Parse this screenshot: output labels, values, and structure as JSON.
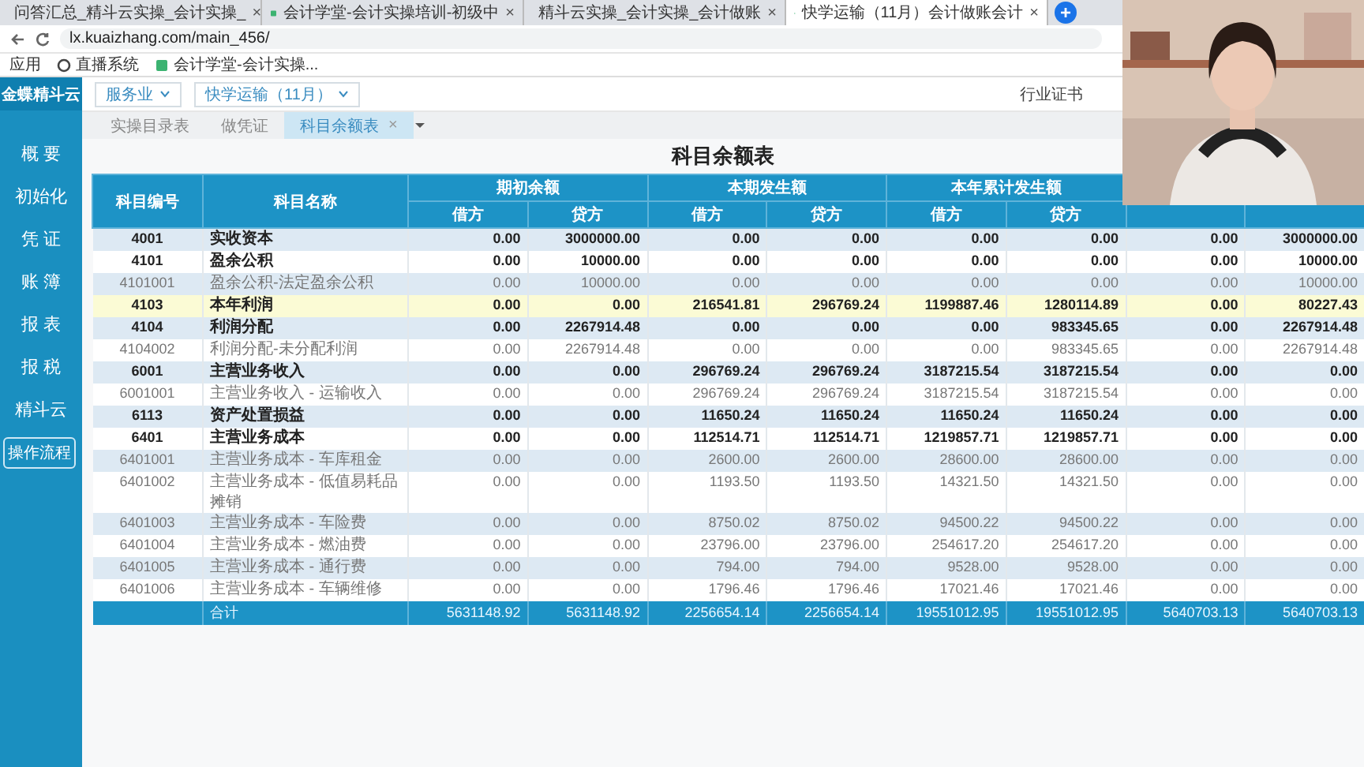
{
  "browser": {
    "tabs": [
      {
        "title": "问答汇总_精斗云实操_会计实操_",
        "selected": false,
        "close": "×"
      },
      {
        "title": "会计学堂-会计实操培训-初级中",
        "selected": false,
        "close": "×"
      },
      {
        "title": "精斗云实操_会计实操_会计做账",
        "selected": false,
        "close": "×"
      },
      {
        "title": "快学运输（11月）会计做账会计",
        "selected": true,
        "close": "×"
      }
    ],
    "new_tab": "+",
    "address": "lx.kuaizhang.com/main_456/",
    "bookmarks": [
      "应用",
      "直播系统",
      "会计学堂-会计实操..."
    ]
  },
  "app": {
    "logo": "金蝶精斗云",
    "sidebar": {
      "items": [
        "概 要",
        "初始化",
        "凭 证",
        "账 簿",
        "报 表",
        "报 税",
        "精斗云"
      ],
      "button": "操作流程"
    },
    "topbar": {
      "industry": "服务业",
      "company": "快学运输（11月）",
      "right_link": "行业证书"
    },
    "tabs": [
      {
        "label": "实操目录表",
        "selected": false
      },
      {
        "label": "做凭证",
        "selected": false
      },
      {
        "label": "科目余额表",
        "selected": true,
        "close": "×"
      }
    ],
    "title": "科目余额表",
    "table": {
      "columns": [
        "科目编号",
        "科目名称"
      ],
      "groups": [
        {
          "label": "期初余额",
          "sub": [
            "借方",
            "贷方"
          ]
        },
        {
          "label": "本期发生额",
          "sub": [
            "借方",
            "贷方"
          ]
        },
        {
          "label": "本年累计发生额",
          "sub": [
            "借方",
            "贷方"
          ]
        }
      ],
      "rows": [
        {
          "code": "4001",
          "name": "实收资本",
          "kind": "summary",
          "selected": false,
          "values": [
            "0.00",
            "3000000.00",
            "0.00",
            "0.00",
            "0.00",
            "0.00",
            "0.00",
            "3000000.00"
          ]
        },
        {
          "code": "4101",
          "name": "盈余公积",
          "kind": "summary",
          "selected": false,
          "values": [
            "0.00",
            "10000.00",
            "0.00",
            "0.00",
            "0.00",
            "0.00",
            "0.00",
            "10000.00"
          ]
        },
        {
          "code": "4101001",
          "name": "盈余公积-法定盈余公积",
          "kind": "detail",
          "selected": false,
          "values": [
            "0.00",
            "10000.00",
            "0.00",
            "0.00",
            "0.00",
            "0.00",
            "0.00",
            "10000.00"
          ]
        },
        {
          "code": "4103",
          "name": "本年利润",
          "kind": "summary",
          "selected": true,
          "values": [
            "0.00",
            "0.00",
            "216541.81",
            "296769.24",
            "1199887.46",
            "1280114.89",
            "0.00",
            "80227.43"
          ]
        },
        {
          "code": "4104",
          "name": "利润分配",
          "kind": "summary",
          "selected": false,
          "values": [
            "0.00",
            "2267914.48",
            "0.00",
            "0.00",
            "0.00",
            "983345.65",
            "0.00",
            "2267914.48"
          ]
        },
        {
          "code": "4104002",
          "name": "利润分配-未分配利润",
          "kind": "detail",
          "selected": false,
          "values": [
            "0.00",
            "2267914.48",
            "0.00",
            "0.00",
            "0.00",
            "983345.65",
            "0.00",
            "2267914.48"
          ]
        },
        {
          "code": "6001",
          "name": "主营业务收入",
          "kind": "summary",
          "selected": false,
          "values": [
            "0.00",
            "0.00",
            "296769.24",
            "296769.24",
            "3187215.54",
            "3187215.54",
            "0.00",
            "0.00"
          ]
        },
        {
          "code": "6001001",
          "name": "主营业务收入 - 运输收入",
          "kind": "detail",
          "selected": false,
          "values": [
            "0.00",
            "0.00",
            "296769.24",
            "296769.24",
            "3187215.54",
            "3187215.54",
            "0.00",
            "0.00"
          ]
        },
        {
          "code": "6113",
          "name": "资产处置损益",
          "kind": "summary",
          "selected": false,
          "values": [
            "0.00",
            "0.00",
            "11650.24",
            "11650.24",
            "11650.24",
            "11650.24",
            "0.00",
            "0.00"
          ]
        },
        {
          "code": "6401",
          "name": "主营业务成本",
          "kind": "summary",
          "selected": false,
          "values": [
            "0.00",
            "0.00",
            "112514.71",
            "112514.71",
            "1219857.71",
            "1219857.71",
            "0.00",
            "0.00"
          ]
        },
        {
          "code": "6401001",
          "name": "主营业务成本 - 车库租金",
          "kind": "detail",
          "selected": false,
          "values": [
            "0.00",
            "0.00",
            "2600.00",
            "2600.00",
            "28600.00",
            "28600.00",
            "0.00",
            "0.00"
          ]
        },
        {
          "code": "6401002",
          "name": "主营业务成本 - 低值易耗品摊销",
          "kind": "detail",
          "selected": false,
          "values": [
            "0.00",
            "0.00",
            "1193.50",
            "1193.50",
            "14321.50",
            "14321.50",
            "0.00",
            "0.00"
          ]
        },
        {
          "code": "6401003",
          "name": "主营业务成本 - 车险费",
          "kind": "detail",
          "selected": false,
          "values": [
            "0.00",
            "0.00",
            "8750.02",
            "8750.02",
            "94500.22",
            "94500.22",
            "0.00",
            "0.00"
          ]
        },
        {
          "code": "6401004",
          "name": "主营业务成本 - 燃油费",
          "kind": "detail",
          "selected": false,
          "values": [
            "0.00",
            "0.00",
            "23796.00",
            "23796.00",
            "254617.20",
            "254617.20",
            "0.00",
            "0.00"
          ]
        },
        {
          "code": "6401005",
          "name": "主营业务成本 - 通行费",
          "kind": "detail",
          "selected": false,
          "values": [
            "0.00",
            "0.00",
            "794.00",
            "794.00",
            "9528.00",
            "9528.00",
            "0.00",
            "0.00"
          ]
        },
        {
          "code": "6401006",
          "name": "主营业务成本 - 车辆维修",
          "kind": "detail",
          "selected": false,
          "values": [
            "0.00",
            "0.00",
            "1796.46",
            "1796.46",
            "17021.46",
            "17021.46",
            "0.00",
            "0.00"
          ]
        }
      ],
      "footer": {
        "label": "合计",
        "values": [
          "5631148.92",
          "5631148.92",
          "2256654.14",
          "2256654.14",
          "19551012.95",
          "19551012.95",
          "5640703.13",
          "5640703.13"
        ]
      }
    }
  }
}
